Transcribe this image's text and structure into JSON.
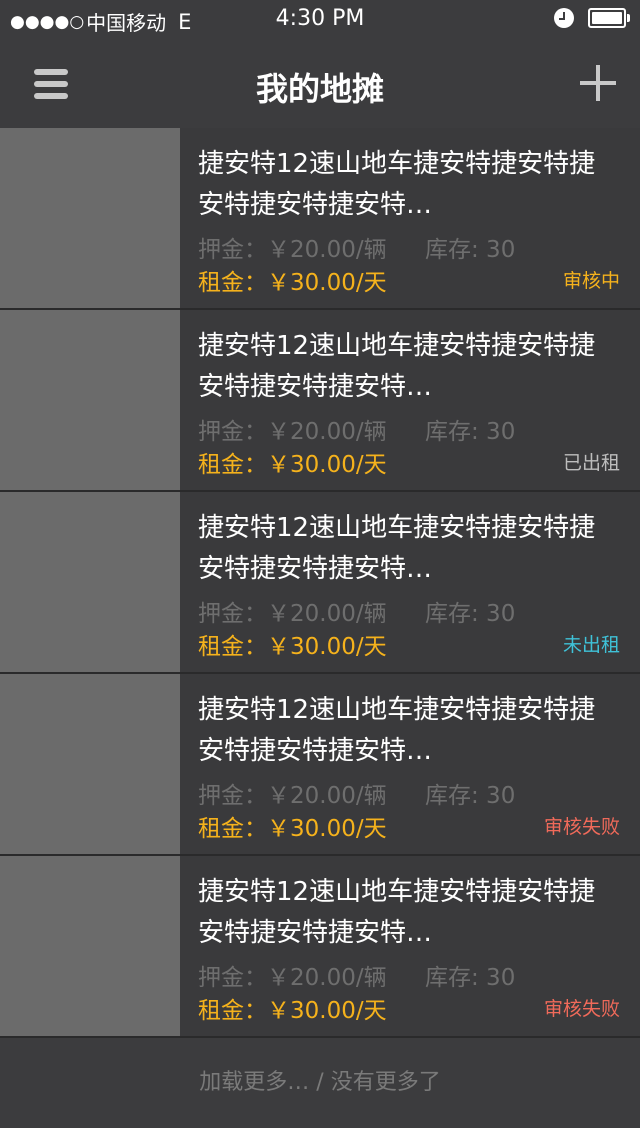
{
  "status_bar": {
    "signal": "●●●●○",
    "carrier": "中国移动",
    "network": "E",
    "time": "4:30 PM"
  },
  "nav": {
    "title": "我的地摊",
    "menu_icon": "hamburger-menu-icon",
    "add_icon": "plus-icon"
  },
  "items": [
    {
      "title": "捷安特12速山地车捷安特捷安特捷安特捷安特捷安特…",
      "deposit": "押金：￥20.00/辆",
      "stock": "库存: 30",
      "rent": "租金：￥30.00/天",
      "status": "审核中",
      "status_color": "#f5b21c"
    },
    {
      "title": "捷安特12速山地车捷安特捷安特捷安特捷安特捷安特…",
      "deposit": "押金：￥20.00/辆",
      "stock": "库存: 30",
      "rent": "租金：￥30.00/天",
      "status": "已出租",
      "status_color": "#bdbdbd"
    },
    {
      "title": "捷安特12速山地车捷安特捷安特捷安特捷安特捷安特…",
      "deposit": "押金：￥20.00/辆",
      "stock": "库存: 30",
      "rent": "租金：￥30.00/天",
      "status": "未出租",
      "status_color": "#3fc2d8"
    },
    {
      "title": "捷安特12速山地车捷安特捷安特捷安特捷安特捷安特…",
      "deposit": "押金：￥20.00/辆",
      "stock": "库存: 30",
      "rent": "租金：￥30.00/天",
      "status": "审核失败",
      "status_color": "#f06a5a"
    },
    {
      "title": "捷安特12速山地车捷安特捷安特捷安特捷安特捷安特…",
      "deposit": "押金：￥20.00/辆",
      "stock": "库存: 30",
      "rent": "租金：￥30.00/天",
      "status": "审核失败",
      "status_color": "#f06a5a"
    }
  ],
  "footer": {
    "load_more": "加载更多… / 没有更多了"
  }
}
